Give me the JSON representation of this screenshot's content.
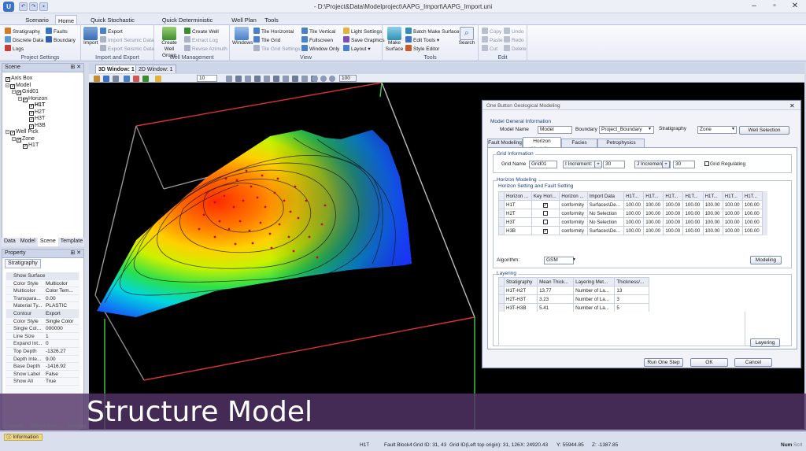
{
  "window": {
    "title": "- D:\\Project&Data\\Modelproject\\AAPG_Import\\AAPG_Import.uni",
    "logo": "app-logo",
    "quick_access": [
      "undo-icon",
      "redo-icon",
      "save-icon"
    ],
    "controls": [
      "minimize-icon",
      "maximize-icon",
      "close-icon"
    ]
  },
  "ribbon_tabs": [
    "Scenario",
    "Home",
    "Quick Stochastic Modeling",
    "Quick Deterministic Modeling",
    "Well Plan",
    "Tools"
  ],
  "ribbon": {
    "project_settings": {
      "label": "Project Settings",
      "items": [
        "Stratigraphy",
        "Faults",
        "Discrete Data",
        "Boundary",
        "Logs"
      ]
    },
    "import_export": {
      "label": "Import and Export",
      "import": "Import",
      "export": "Export",
      "import_seismic": "Import Seismic Data",
      "export_seismic": "Export Seismic Data"
    },
    "well_management": {
      "label": "Well Management",
      "create_group": "Create Well Group",
      "create_well": "Create Well",
      "extract_log": "Extract Log",
      "revise_azimuth": "Revise Azimuth"
    },
    "view": {
      "label": "View",
      "windows": "Windows",
      "tile_horizontal": "Tile Horizontal",
      "tile_grid": "Tile Grid",
      "tile_grid_settings": "Tile Grid Settings",
      "tile_vertical": "Tile Vertical",
      "fullscreen": "Fullscreen",
      "window_only": "Window Only",
      "light_settings": "Light Settings",
      "save_graphics": "Save Graphics",
      "layout": "Layout"
    },
    "tools": {
      "label": "Tools",
      "make_surface": "Make Surface",
      "batch_make_surface": "Batch Make Surface",
      "edit_tools": "Edit Tools",
      "style_editor": "Style Editor",
      "search": "Search"
    },
    "edit": {
      "label": "Edit",
      "copy": "Copy",
      "undo": "Undo",
      "paste": "Paste",
      "redo": "Redo",
      "cut": "Cut",
      "delete": "Delete"
    }
  },
  "scene": {
    "title": "Scene",
    "tree": [
      {
        "label": "Axis Box",
        "level": 0
      },
      {
        "label": "Model",
        "level": 0
      },
      {
        "label": "Grid01",
        "level": 1
      },
      {
        "label": "Horizon",
        "level": 2
      },
      {
        "label": "H1T",
        "level": 3,
        "bold": true
      },
      {
        "label": "H2T",
        "level": 3
      },
      {
        "label": "H3T",
        "level": 3
      },
      {
        "label": "H3B",
        "level": 3
      },
      {
        "label": "Well Pick",
        "level": 0
      },
      {
        "label": "Zone",
        "level": 1
      },
      {
        "label": "H1T",
        "level": 2
      }
    ],
    "tabs": [
      "Data",
      "Model",
      "Scene",
      "Template"
    ]
  },
  "property": {
    "title": "Property",
    "tab": "Stratigraphy",
    "rows": [
      {
        "k": "Show Surface",
        "v": ""
      },
      {
        "k": "Color Style",
        "v": "Multicolor"
      },
      {
        "k": "Multicolor",
        "v": "Color Tem..."
      },
      {
        "k": "Transpara...",
        "v": "0.00"
      },
      {
        "k": "Material Ty...",
        "v": "PLASTIC"
      },
      {
        "k": "Contour",
        "v": "Export"
      },
      {
        "k": "Color Style",
        "v": "Single Color"
      },
      {
        "k": "Single Col...",
        "v": "000000"
      },
      {
        "k": "Line Size",
        "v": "1"
      },
      {
        "k": "Expand Int...",
        "v": "0"
      },
      {
        "k": "Top Depth",
        "v": "-1326.27"
      },
      {
        "k": "Depth Inte...",
        "v": "9.00"
      },
      {
        "k": "Base Depth",
        "v": "-1416.92"
      },
      {
        "k": "Show Label",
        "v": "False"
      },
      {
        "k": "Show All",
        "v": "True"
      }
    ],
    "bottom_tabs": [
      "Property",
      "Object Prop...",
      "Window"
    ]
  },
  "doc_tabs": [
    "3D Window: 1",
    "2D Window: 1"
  ],
  "toolbar": {
    "zoom": "10",
    "opacity": "100"
  },
  "dialog": {
    "title": "One Button Geological Modeling",
    "general_label": "Model General Information",
    "model_name_label": "Model Name",
    "model_name": "Model",
    "boundary_label": "Boundary",
    "boundary": "Project_Boundary",
    "stratigraphy_label": "Stratigraphy",
    "stratigraphy": "Zone",
    "well_selection": "Well Selection",
    "tabs": [
      "Fault Modeling",
      "Horizon Modeling",
      "Facies Modeling",
      "Petrophysics Modeling"
    ],
    "grid_info_label": "Grid Information",
    "grid_name_label": "Grid Name",
    "grid_name": "Grid01",
    "i_inc_label": "I Increment:",
    "i_inc": "30",
    "j_inc_label": "J Increment:",
    "j_inc": "30",
    "grid_regulating": "Grid Regulating",
    "horizon_label": "Horizon Modeling",
    "horizon_setting_label": "Horizon Setting and Fault Setting",
    "horizon_cols": [
      "Horizon ...",
      "Key Hori...",
      "Horizon ...",
      "Import Data",
      "H1T...",
      "H1T...",
      "H1T...",
      "H1T...",
      "H1T...",
      "H1T...",
      "H1T..."
    ],
    "horizon_rows": [
      {
        "name": "H1T",
        "key": true,
        "type": "conformity",
        "data": "Surfaces\\De...",
        "vals": [
          "100.00",
          "100.00",
          "100.00",
          "100.00",
          "100.00",
          "100.00",
          "100.00"
        ]
      },
      {
        "name": "H2T",
        "key": false,
        "type": "conformity",
        "data": "No Selection",
        "vals": [
          "100.00",
          "100.00",
          "100.00",
          "100.00",
          "100.00",
          "100.00",
          "100.00"
        ]
      },
      {
        "name": "H3T",
        "key": false,
        "type": "conformity",
        "data": "No Selection",
        "vals": [
          "100.00",
          "100.00",
          "100.00",
          "100.00",
          "100.00",
          "100.00",
          "100.00"
        ]
      },
      {
        "name": "H3B",
        "key": true,
        "type": "conformity",
        "data": "Surfaces\\De...",
        "vals": [
          "100.00",
          "100.00",
          "100.00",
          "100.00",
          "100.00",
          "100.00",
          "100.00"
        ]
      }
    ],
    "algorithm_label": "Algorithm:",
    "algorithm": "GSM",
    "modeling_btn": "Modeling",
    "layering_label": "Layering",
    "layer_cols": [
      "Stratigraphy",
      "Mean Thick...",
      "Layering Met...",
      "Thickness/..."
    ],
    "layer_rows": [
      {
        "s": "H1T-H2T",
        "t": "13.77",
        "m": "Number of La...",
        "n": "13"
      },
      {
        "s": "H2T-H3T",
        "t": "3.23",
        "m": "Number of La...",
        "n": "3"
      },
      {
        "s": "H3T-H3B",
        "t": "5.41",
        "m": "Number of La...",
        "n": "5"
      }
    ],
    "layering_btn": "Layering",
    "run_btn": "Run One Step",
    "ok_btn": "OK",
    "cancel_btn": "Cancel"
  },
  "caption": "Structure Model",
  "status": {
    "info_tab": "Information",
    "horizon": "H1T",
    "fault_block": "Fault Block4",
    "grid_id": "Grid ID: 31, 43",
    "grid_id_left": "Grid ID(Left top origin): 31, 126",
    "x": "X: 24920.43",
    "y": "Y: 55944.85",
    "z": "Z: -1387.85",
    "num": "Num",
    "extra": "Scrl"
  },
  "colors": {
    "accent": "#3a72c8",
    "caption_bg": "#523468",
    "viewport": "#000000"
  }
}
